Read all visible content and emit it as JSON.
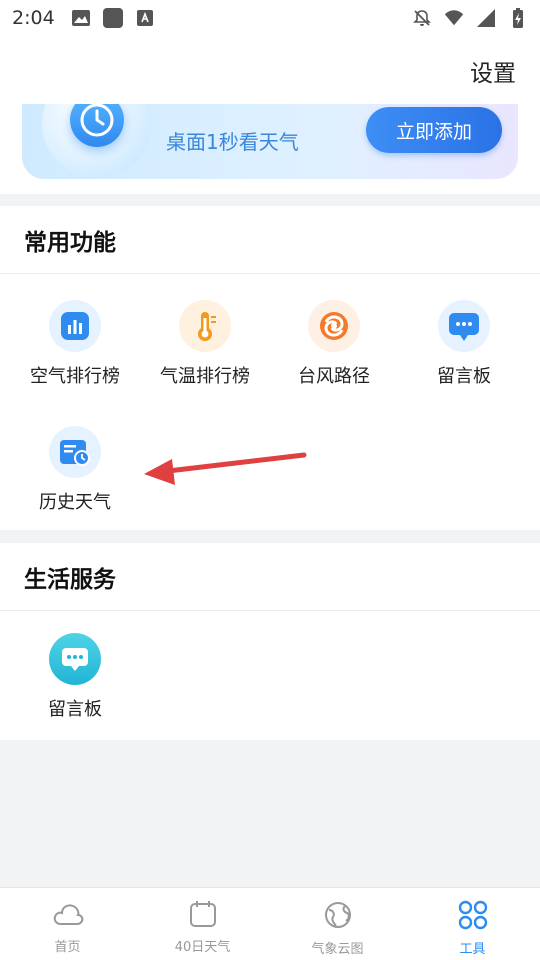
{
  "status_bar": {
    "time": "2:04"
  },
  "header": {
    "settings_label": "设置"
  },
  "banner": {
    "subtitle": "桌面1秒看天气",
    "add_button": "立即添加"
  },
  "common_functions": {
    "title": "常用功能",
    "items": [
      {
        "label": "空气排行榜",
        "icon": "air-ranking-icon"
      },
      {
        "label": "气温排行榜",
        "icon": "thermometer-icon"
      },
      {
        "label": "台风路径",
        "icon": "typhoon-icon"
      },
      {
        "label": "留言板",
        "icon": "message-board-icon"
      },
      {
        "label": "历史天气",
        "icon": "history-weather-icon"
      }
    ]
  },
  "life_services": {
    "title": "生活服务",
    "items": [
      {
        "label": "留言板",
        "icon": "message-board-icon"
      }
    ]
  },
  "annotation": {
    "arrow_color": "#e04040"
  },
  "tabbar": {
    "tabs": [
      {
        "label": "首页",
        "icon": "cloud-icon"
      },
      {
        "label": "40日天气",
        "icon": "calendar-icon"
      },
      {
        "label": "气象云图",
        "icon": "globe-icon"
      },
      {
        "label": "工具",
        "icon": "tools-icon"
      }
    ],
    "active_index": 3
  },
  "colors": {
    "accent": "#2d8cf0"
  }
}
